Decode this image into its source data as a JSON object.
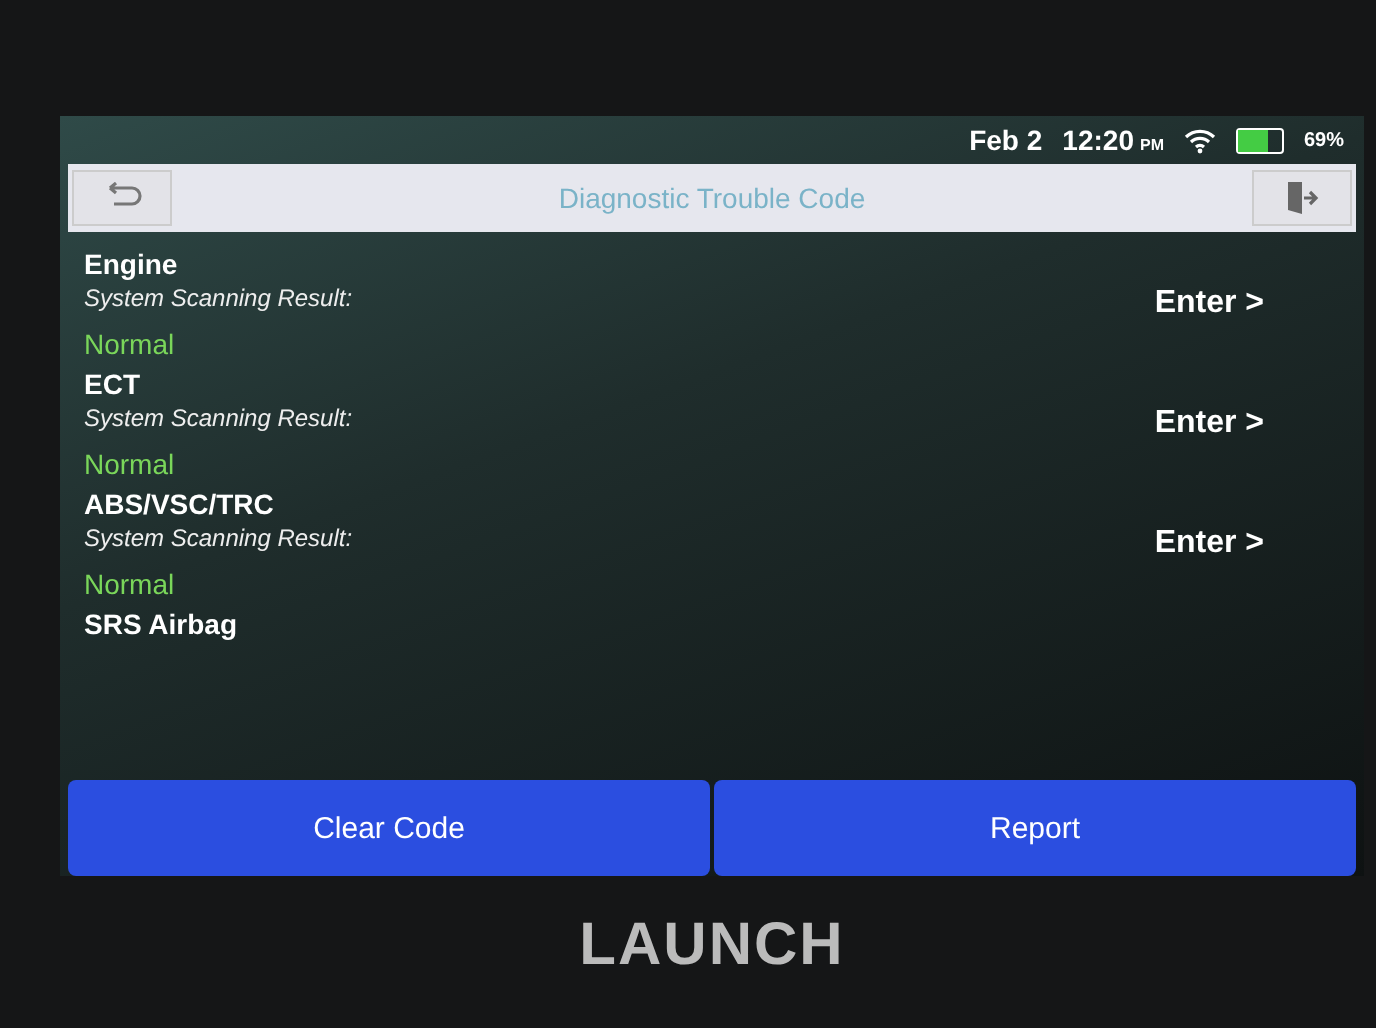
{
  "status_bar": {
    "date": "Feb 2",
    "time": "12:20",
    "ampm": "PM",
    "battery": {
      "level": 0.69,
      "text": "69%"
    }
  },
  "header": {
    "title": "Diagnostic Trouble Code"
  },
  "systems": [
    {
      "name": "Engine",
      "label": "System Scanning Result:",
      "result": "Normal",
      "action": "Enter >"
    },
    {
      "name": "ECT",
      "label": "System Scanning Result:",
      "result": "Normal",
      "action": "Enter >"
    },
    {
      "name": "ABS/VSC/TRC",
      "label": "System Scanning Result:",
      "result": "Normal",
      "action": "Enter >"
    },
    {
      "name": "SRS Airbag"
    }
  ],
  "buttons": [
    "Clear Code",
    "Report"
  ],
  "device": {
    "brand": "LAUNCH"
  }
}
